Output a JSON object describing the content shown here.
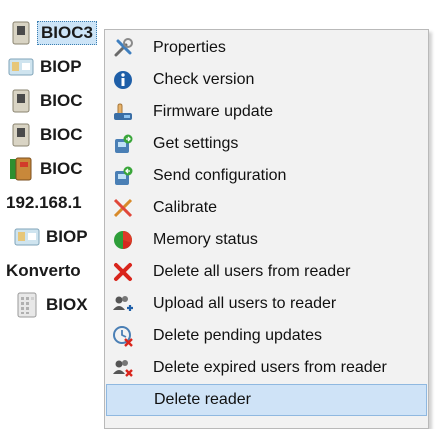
{
  "tree": {
    "items": [
      {
        "label": "BIOC3",
        "icon": "device-small-icon"
      },
      {
        "label": "BIOP",
        "icon": "pro-device-icon"
      },
      {
        "label": "BIOC",
        "icon": "device-small-icon"
      },
      {
        "label": "BIOC",
        "icon": "device-small-icon"
      },
      {
        "label": "BIOC",
        "icon": "book-device-icon"
      },
      {
        "label": "192.168.1",
        "icon": ""
      },
      {
        "label": "BIOP",
        "icon": "pro-device-icon"
      },
      {
        "label": "Konverto",
        "icon": ""
      },
      {
        "label": "BIOX",
        "icon": "keypad-device-icon"
      }
    ]
  },
  "menu": {
    "items": [
      {
        "label": "Properties",
        "icon": "tools-icon"
      },
      {
        "label": "Check version",
        "icon": "info-icon"
      },
      {
        "label": "Firmware update",
        "icon": "hand-update-icon"
      },
      {
        "label": "Get settings",
        "icon": "get-settings-icon"
      },
      {
        "label": "Send configuration",
        "icon": "send-config-icon"
      },
      {
        "label": "Calibrate",
        "icon": "calibrate-icon"
      },
      {
        "label": "Memory status",
        "icon": "memory-pie-icon"
      },
      {
        "label": "Delete all users from reader",
        "icon": "red-x-icon"
      },
      {
        "label": "Upload all users to reader",
        "icon": "users-upload-icon"
      },
      {
        "label": "Delete pending updates",
        "icon": "delete-pending-icon"
      },
      {
        "label": "Delete expired users from reader",
        "icon": "users-expired-icon"
      },
      {
        "label": "Delete reader",
        "icon": ""
      }
    ],
    "hovered_index": 11
  },
  "colors": {
    "selection": "#cce4f7",
    "menu_bg": "#f2f2f2",
    "hover": "#cfe3f7"
  }
}
